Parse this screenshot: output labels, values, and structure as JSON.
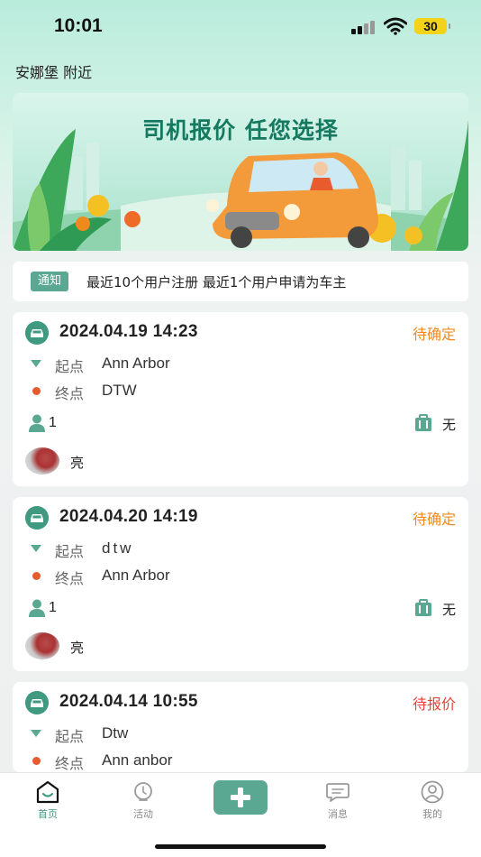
{
  "status_bar": {
    "time": "10:01",
    "battery": "30"
  },
  "location": "安娜堡 附近",
  "banner": {
    "title": "司机报价 任您选择"
  },
  "notice": {
    "tag": "通知",
    "text": "最近10个用户注册 最近1个用户申请为车主"
  },
  "route_labels": {
    "start": "起点",
    "end": "终点"
  },
  "trips": [
    {
      "datetime": "2024.04.19 14:23",
      "status": "待确定",
      "start": "Ann Arbor",
      "end": "DTW",
      "passengers": "1",
      "luggage": "无",
      "driver": "亮"
    },
    {
      "datetime": "2024.04.20 14:19",
      "status": "待确定",
      "start": "dtw",
      "end": "Ann Arbor",
      "passengers": "1",
      "luggage": "无",
      "driver": "亮"
    },
    {
      "datetime": "2024.04.14 10:55",
      "status": "待报价",
      "start": "Dtw",
      "end": "Ann anbor"
    }
  ],
  "tabbar": {
    "home": "首页",
    "activity": "活动",
    "messages": "消息",
    "mine": "我的"
  },
  "colors": {
    "accent": "#5aa891",
    "pending_confirm": "#f08a1d",
    "pending_quote": "#e8423a"
  }
}
